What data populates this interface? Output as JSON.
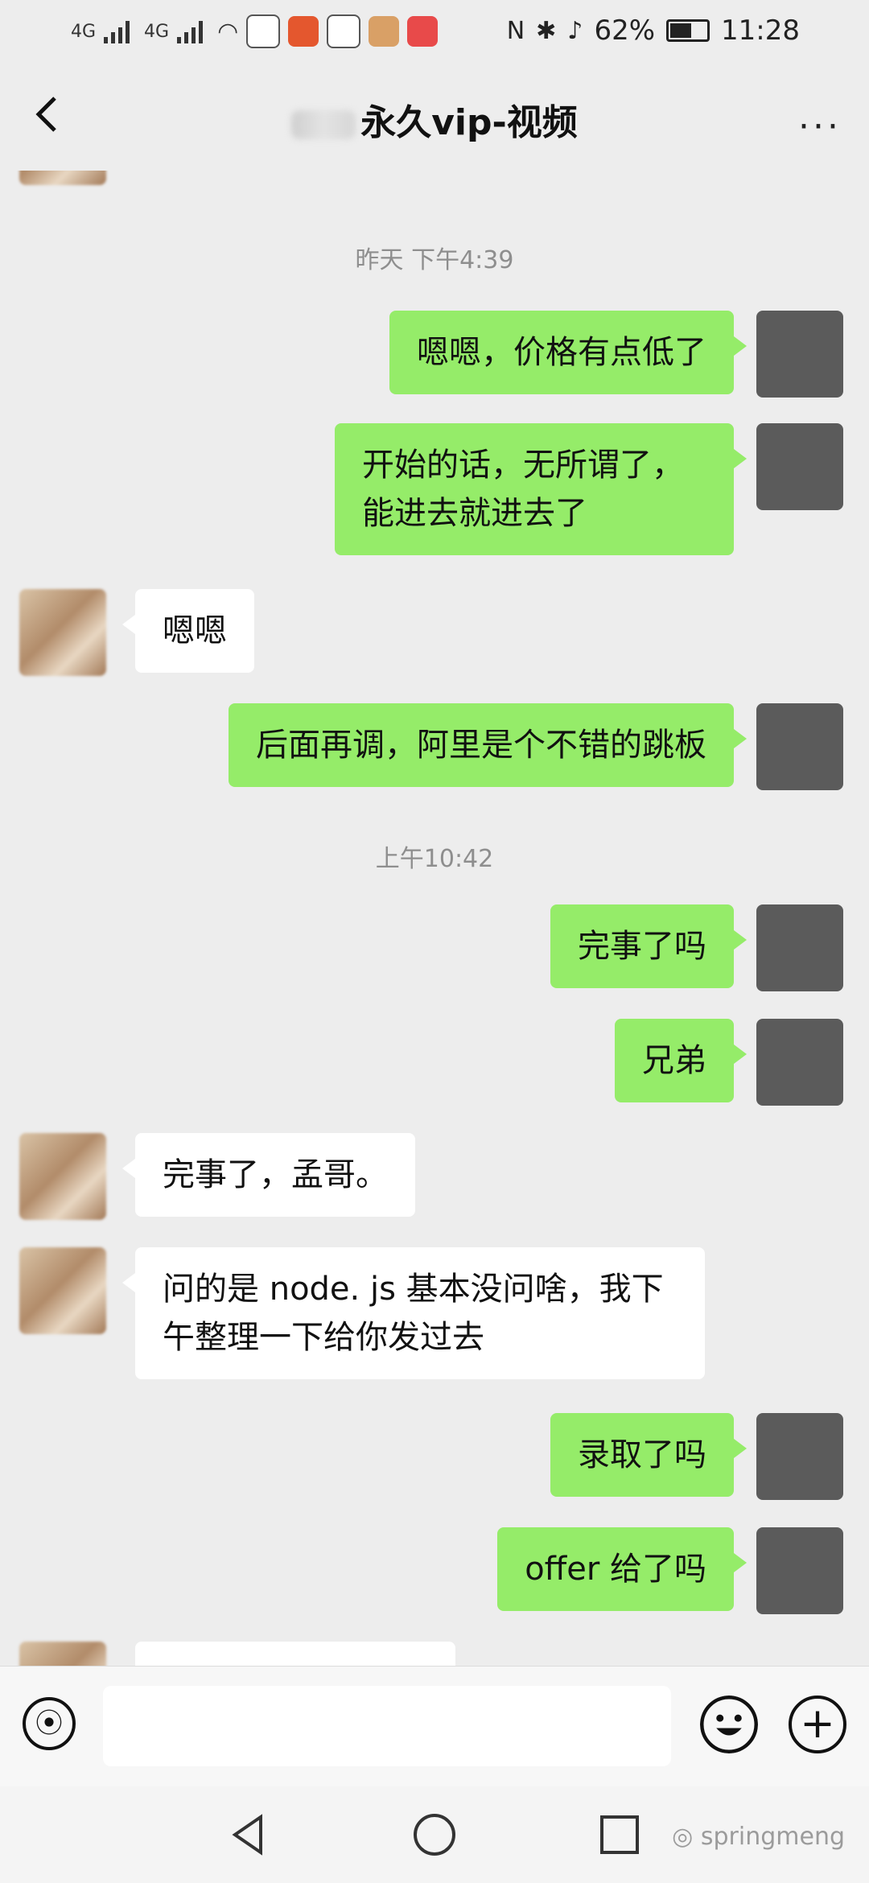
{
  "status_bar": {
    "left_network_1": "4G",
    "left_network_2": "4G",
    "battery": "62%",
    "time": "11:28"
  },
  "header": {
    "title": "永久vip-视频",
    "back_icon": "back-chevron",
    "more_icon": "more-dots",
    "more_label": "···"
  },
  "messages": [
    {
      "type": "time",
      "text": "昨天 下午4:39"
    },
    {
      "type": "me",
      "text": "嗯嗯，价格有点低了"
    },
    {
      "type": "me",
      "text": "开始的话，无所谓了，能进去就进去了"
    },
    {
      "type": "other",
      "text": "嗯嗯"
    },
    {
      "type": "me",
      "text": "后面再调，阿里是个不错的跳板"
    },
    {
      "type": "time",
      "text": "上午10:42"
    },
    {
      "type": "me",
      "text": "完事了吗"
    },
    {
      "type": "me",
      "text": "兄弟"
    },
    {
      "type": "other",
      "text": "完事了，孟哥。"
    },
    {
      "type": "other",
      "text": "问的是 node. js 基本没问啥，我下午整理一下给你发过去"
    },
    {
      "type": "me",
      "text": "录取了吗"
    },
    {
      "type": "me",
      "text": "offer 给了吗"
    }
  ],
  "input_bar": {
    "voice_icon": "voice-icon",
    "emoji_icon": "emoji-icon",
    "plus_icon": "plus-icon",
    "plus_label": "+"
  },
  "nav_bar": {
    "back": "nav-back-triangle",
    "home": "nav-home-circle",
    "recents": "nav-recents-square"
  },
  "watermark": "springmeng",
  "colors": {
    "background": "#ededed",
    "my_bubble": "#95ec69",
    "other_bubble": "#ffffff",
    "time_text": "#8e8e8e"
  }
}
